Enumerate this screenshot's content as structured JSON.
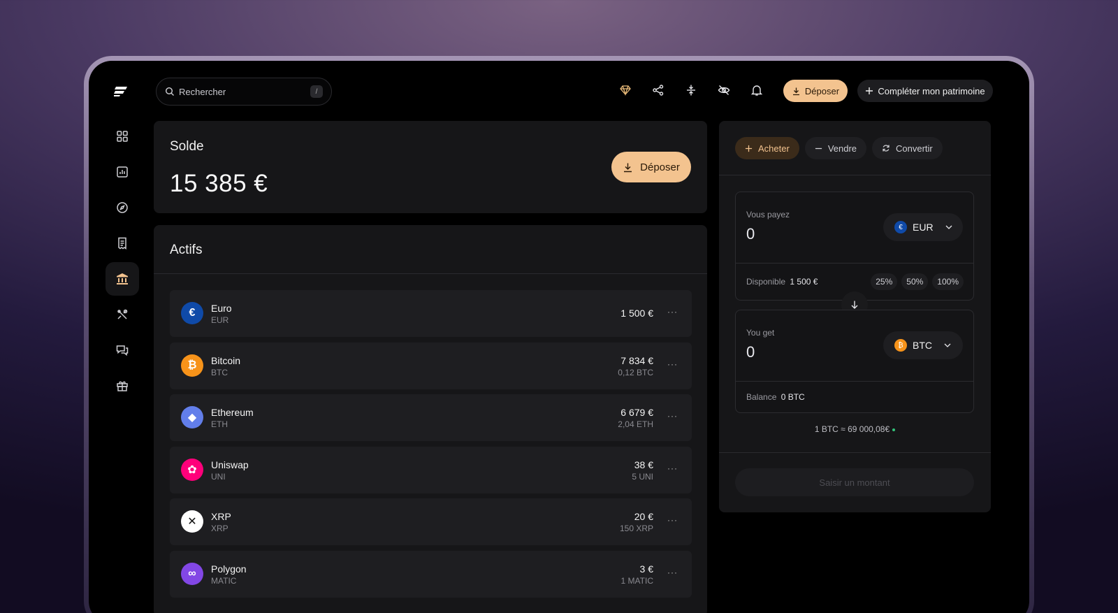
{
  "search": {
    "placeholder": "Rechercher",
    "shortcut": "/"
  },
  "header": {
    "deposit_label": "Déposer",
    "complete_label": "Compléter mon patrimoine"
  },
  "balance": {
    "label": "Solde",
    "value": "15 385 €",
    "deposit_label": "Déposer"
  },
  "assets": {
    "title": "Actifs",
    "items": [
      {
        "name": "Euro",
        "ticker": "EUR",
        "value": "1 500 €",
        "qty": "",
        "color": "#0f4aa8",
        "glyph": "€"
      },
      {
        "name": "Bitcoin",
        "ticker": "BTC",
        "value": "7 834 €",
        "qty": "0,12 BTC",
        "color": "#f7931a",
        "glyph": "₿"
      },
      {
        "name": "Ethereum",
        "ticker": "ETH",
        "value": "6 679 €",
        "qty": "2,04 ETH",
        "color": "#627eea",
        "glyph": "◆"
      },
      {
        "name": "Uniswap",
        "ticker": "UNI",
        "value": "38 €",
        "qty": "5 UNI",
        "color": "#ff007a",
        "glyph": "✿"
      },
      {
        "name": "XRP",
        "ticker": "XRP",
        "value": "20 €",
        "qty": "150 XRP",
        "color": "#ffffff",
        "glyph": "✕"
      },
      {
        "name": "Polygon",
        "ticker": "MATIC",
        "value": "3 €",
        "qty": "1 MATIC",
        "color": "#8247e5",
        "glyph": "∞"
      }
    ],
    "more_label": "···"
  },
  "trade": {
    "tabs": [
      {
        "label": "Acheter",
        "active": true
      },
      {
        "label": "Vendre",
        "active": false
      },
      {
        "label": "Convertir",
        "active": false
      }
    ],
    "pay": {
      "label": "Vous payez",
      "amount": "0",
      "currency": "EUR",
      "currency_glyph": "€"
    },
    "available": {
      "label": "Disponible",
      "value": "1 500 €"
    },
    "percentages": [
      "25%",
      "50%",
      "100%"
    ],
    "get": {
      "label": "You get",
      "amount": "0",
      "currency": "BTC",
      "currency_glyph": "₿"
    },
    "balance": {
      "label": "Balance",
      "value": "0 BTC"
    },
    "rate": "1 BTC ≈ 69 000,08€",
    "submit_label": "Saisir un montant"
  },
  "colors": {
    "accent": "#f3c38f",
    "accent_text": "#2a1a08",
    "positive": "#33c27a"
  }
}
